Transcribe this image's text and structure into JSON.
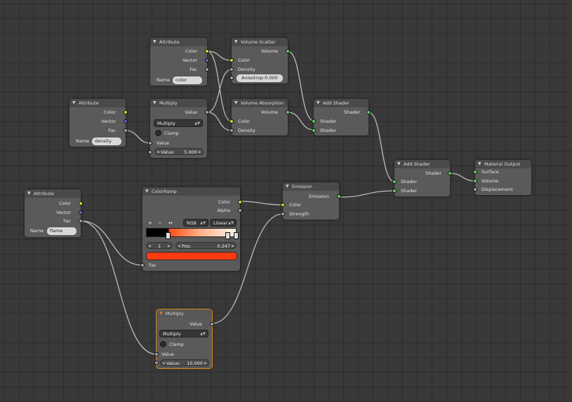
{
  "colors": {
    "background": "#393939",
    "link": "#bcbcbc",
    "socket_color": "#d6d62a",
    "socket_vector": "#6363c7",
    "socket_value": "#a1a1a1",
    "socket_shader": "#5fd25f",
    "active_outline": "#d88a1a",
    "colorband_selected": "#ff3b12"
  },
  "nodes": {
    "attr_color": {
      "title": "Attribute",
      "out_color": "Color",
      "out_vector": "Vector",
      "out_fac": "Fac",
      "name_label": "Name",
      "name_value": "color"
    },
    "volume_scatter": {
      "title": "Volume Scatter",
      "out_volume": "Volume",
      "in_color": "Color",
      "in_density": "Density",
      "anisotropy_label": "Anisotrop:",
      "anisotropy_value": "0.000"
    },
    "attr_density": {
      "title": "Attribute",
      "out_color": "Color",
      "out_vector": "Vector",
      "out_fac": "Fac",
      "name_label": "Name",
      "name_value": "density"
    },
    "multiply_top": {
      "title": "Multiply",
      "out_value": "Value",
      "operation": "Multiply",
      "clamp_label": "Clamp",
      "in_value": "Value",
      "value_label": "Value:",
      "value_value": "5.000"
    },
    "volume_absorption": {
      "title": "Volume Absorption",
      "out_volume": "Volume",
      "in_color": "Color",
      "in_density": "Density"
    },
    "add_shader_1": {
      "title": "Add Shader",
      "out_shader": "Shader",
      "in_shader_a": "Shader",
      "in_shader_b": "Shader"
    },
    "add_shader_2": {
      "title": "Add Shader",
      "out_shader": "Shader",
      "in_shader_a": "Shader",
      "in_shader_b": "Shader"
    },
    "material_output": {
      "title": "Material Output",
      "in_surface": "Surface",
      "in_volume": "Volume",
      "in_displacement": "Displacement"
    },
    "attr_flame": {
      "title": "Attribute",
      "out_color": "Color",
      "out_vector": "Vector",
      "out_fac": "Fac",
      "name_label": "Name",
      "name_value": "flame"
    },
    "color_ramp": {
      "title": "ColorRamp",
      "out_color": "Color",
      "out_alpha": "Alpha",
      "add_label": "+",
      "remove_label": "−",
      "flip_label": "↔",
      "mode": "RGB",
      "interpolation": "Linear",
      "stop_index": "1",
      "pos_label": "Pos:",
      "pos_value": "0.247",
      "in_fac": "Fac"
    },
    "emission": {
      "title": "Emission",
      "out_emission": "Emission",
      "in_color": "Color",
      "in_strength": "Strength"
    },
    "multiply_bottom": {
      "title": "Multiply",
      "out_value": "Value",
      "operation": "Multiply",
      "clamp_label": "Clamp",
      "in_value": "Value",
      "value_label": "Value:",
      "value_value": "10.000"
    }
  }
}
